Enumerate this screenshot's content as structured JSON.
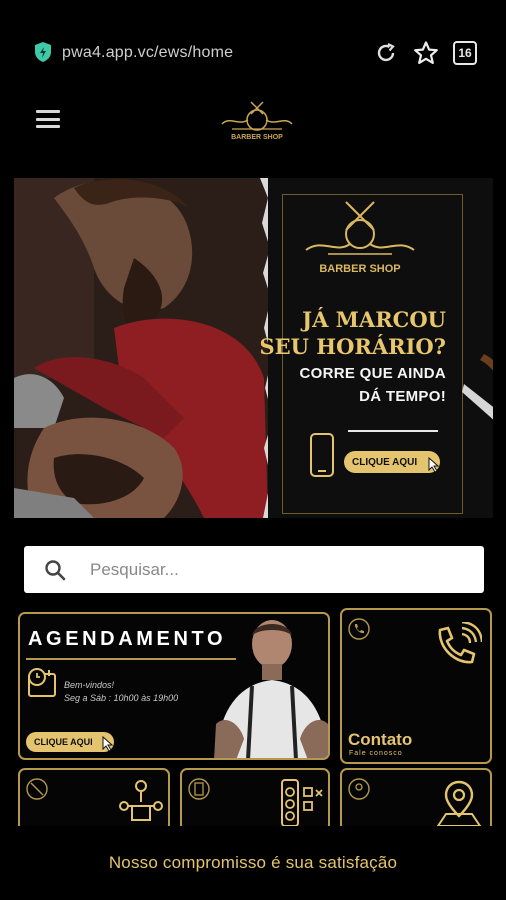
{
  "browser": {
    "url": "pwa4.app.vc/ews/home",
    "tab_count": "16",
    "icons": [
      "shield-icon",
      "reload-icon",
      "star-icon",
      "tabs-counter"
    ]
  },
  "header": {
    "menu_icon": "hamburger-icon",
    "logo_text": "BARBER SHOP"
  },
  "banner": {
    "logo_text": "BARBER SHOP",
    "headline_line1": "JÁ MARCOU",
    "headline_line2": "SEU HORÁRIO?",
    "sub_line1": "CORRE QUE AINDA",
    "sub_line2": "DÁ TEMPO!",
    "cta": "CLIQUE AQUI"
  },
  "search": {
    "placeholder": "Pesquisar..."
  },
  "cards": {
    "agendamento": {
      "title": "AGENDAMENTO",
      "greeting": "Bem-vindos!",
      "hours": "Seg a Sáb : 10h00 às 19h00",
      "cta": "CLIQUE AQUI"
    },
    "contato": {
      "title": "Contato",
      "subtitle": "Fale conosco"
    }
  },
  "footer": {
    "text": "Nosso compromisso é sua satisfação"
  },
  "colors": {
    "gold": "#e4c46e",
    "gold_border": "#b6984e",
    "background": "#000000"
  }
}
